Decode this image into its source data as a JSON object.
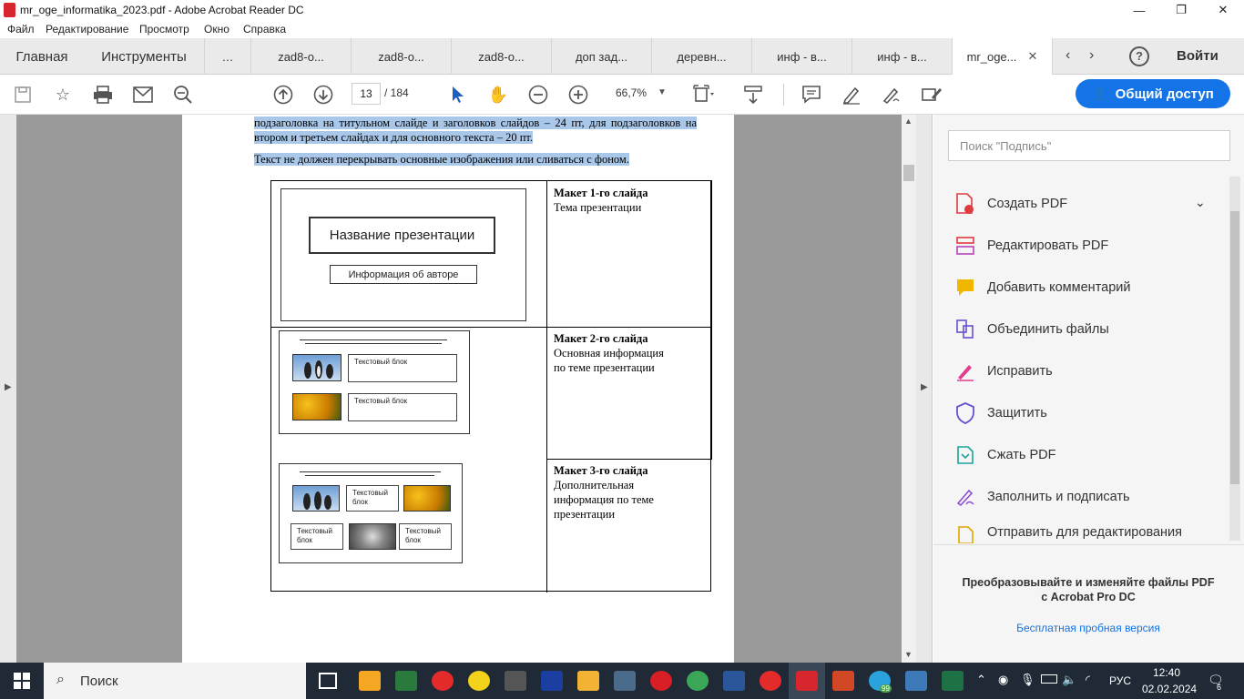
{
  "window": {
    "title": "mr_oge_informatika_2023.pdf - Adobe Acrobat Reader DC"
  },
  "menu": [
    "Файл",
    "Редактирование",
    "Просмотр",
    "Окно",
    "Справка"
  ],
  "tabs": {
    "home": "Главная",
    "tools": "Инструменты",
    "docs": [
      "zad8-o...",
      "zad8-o...",
      "zad8-o...",
      "доп зад...",
      "деревн...",
      "инф - в...",
      "инф - в..."
    ],
    "active": "mr_oge...",
    "signin": "Войти"
  },
  "toolbar": {
    "page_current": "13",
    "page_total": "/ 184",
    "zoom": "66,7%",
    "share": "Общий доступ"
  },
  "document": {
    "para1": "подзаголовка на титульном слайде и заголовков слайдов – 24 пт, для подзаголовков на втором и третьем слайдах и для основного текста – 20 пт.",
    "para2": "Текст не должен перекрывать основные изображения или сливаться с фоном.",
    "slide1": {
      "title": "Название презентации",
      "author": "Информация об авторе",
      "label": "Макет 1-го слайда",
      "desc": "Тема презентации"
    },
    "slide2": {
      "block1": "Текстовый блок",
      "block2": "Текстовый блок",
      "label": "Макет 2-го слайда",
      "desc1": "Основная информация",
      "desc2": "по теме презентации"
    },
    "slide3": {
      "block1": "Текстовый блок",
      "block2": "Текстовый блок",
      "block3": "Текстовый блок",
      "label": "Макет 3-го слайда",
      "desc1": "Дополнительная",
      "desc2": "информация по теме",
      "desc3": "презентации"
    }
  },
  "panel": {
    "search_placeholder": "Поиск \"Подпись\"",
    "items": [
      "Создать PDF",
      "Редактировать PDF",
      "Добавить комментарий",
      "Объединить файлы",
      "Исправить",
      "Защитить",
      "Сжать PDF",
      "Заполнить и подписать",
      "Отправить для редактирования"
    ],
    "promo1": "Преобразовывайте и изменяйте файлы PDF",
    "promo2": "с Acrobat Pro DC",
    "trial": "Бесплатная пробная версия"
  },
  "taskbar": {
    "search": "Поиск",
    "lang": "РУС",
    "time": "12:40",
    "date": "02.02.2024",
    "notif": "6",
    "tg_badge": "99"
  }
}
